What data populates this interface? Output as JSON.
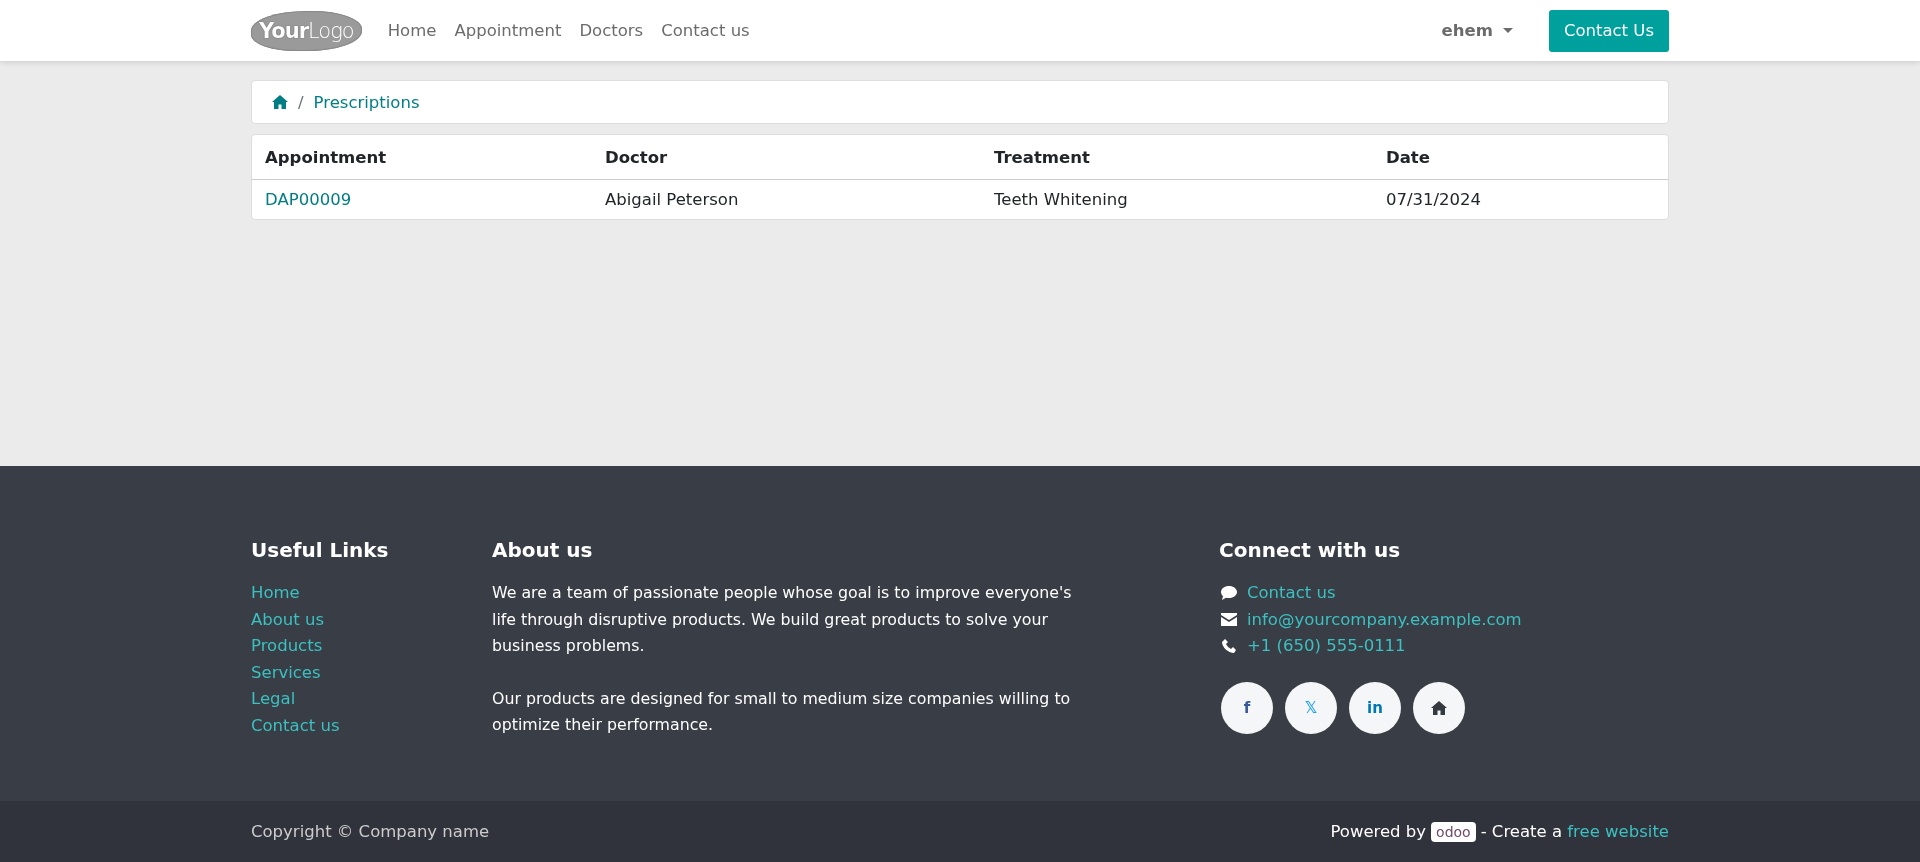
{
  "header": {
    "logo": {
      "bold": "Your",
      "light": "Logo"
    },
    "nav": [
      "Home",
      "Appointment",
      "Doctors",
      "Contact us"
    ],
    "user_menu": "ehem",
    "cta_button": "Contact Us"
  },
  "breadcrumb": {
    "separator": "/",
    "items": [
      "Prescriptions"
    ]
  },
  "table": {
    "columns": [
      "Appointment",
      "Doctor",
      "Treatment",
      "Date"
    ],
    "rows": [
      {
        "cells": [
          "DAP00009",
          "Abigail Peterson",
          "Teeth Whitening",
          "07/31/2024"
        ]
      }
    ]
  },
  "footer": {
    "useful_links": {
      "title": "Useful Links",
      "links": [
        "Home",
        "About us",
        "Products",
        "Services",
        "Legal",
        "Contact us"
      ]
    },
    "about": {
      "title": "About us",
      "paragraphs": [
        "We are a team of passionate people whose goal is to improve everyone's life through disruptive products. We build great products to solve your business problems.",
        "Our products are designed for small to medium size companies willing to optimize their performance."
      ]
    },
    "connect": {
      "title": "Connect with us",
      "contacts": [
        {
          "kind": "chat",
          "text": "Contact us"
        },
        {
          "kind": "mail",
          "text": "info@yourcompany.example.com"
        },
        {
          "kind": "phone",
          "text": "+1 (650) 555-0111"
        }
      ],
      "socials": [
        {
          "kind": "facebook",
          "glyph": "f"
        },
        {
          "kind": "x",
          "glyph": "𝕏"
        },
        {
          "kind": "linkedin",
          "glyph": "in"
        },
        {
          "kind": "home"
        }
      ]
    }
  },
  "bottom_bar": {
    "copyright": "Copyright © Company name",
    "powered_by": "Powered by",
    "brand": "odoo",
    "separator": "- Create a",
    "link": "free website"
  }
}
